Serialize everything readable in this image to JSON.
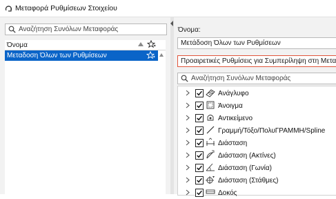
{
  "window": {
    "title": "Μεταφορά Ρυθμίσεων Στοιχείου"
  },
  "left": {
    "search_placeholder": "Αναζήτηση Συνόλων Μεταφοράς",
    "column_header": "Όνομα",
    "items": [
      {
        "label": "Μεταδοση Όλων των Ρυθμίσεων",
        "selected": true
      }
    ]
  },
  "right": {
    "name_label": "Όνομα:",
    "name_value": "Μετάδοση Όλων των Ρυθμίσεων",
    "options_label": "Προαιρετικές Ρυθμίσεις για Συμπερίληψη στη Μεταφορά",
    "search_placeholder": "Αναζήτηση Συνόλων Μεταφοράς",
    "tree": [
      {
        "label": "Ανάγλυφο",
        "checked": true,
        "icon": "relief-icon"
      },
      {
        "label": "Άνοιγμα",
        "checked": true,
        "icon": "opening-icon"
      },
      {
        "label": "Αντικείμενο",
        "checked": true,
        "icon": "object-icon"
      },
      {
        "label": "Γραμμή/Τόξο/ΠολυΓΡΑΜΜΗ/Spline",
        "checked": true,
        "icon": "line-icon"
      },
      {
        "label": "Διάσταση",
        "checked": true,
        "icon": "dimension-icon"
      },
      {
        "label": "Διάσταση (Ακτίνες)",
        "checked": true,
        "icon": "radial-dimension-icon"
      },
      {
        "label": "Διάσταση (Γωνία)",
        "checked": true,
        "icon": "angle-dimension-icon"
      },
      {
        "label": "Διάσταση (Στάθμες)",
        "checked": true,
        "icon": "level-dimension-icon"
      },
      {
        "label": "Δοκός",
        "checked": true,
        "icon": "beam-icon"
      }
    ]
  },
  "colors": {
    "selection": "#0a64c8",
    "highlight_border": "#e0553a",
    "panel": "#f2f2f2"
  }
}
